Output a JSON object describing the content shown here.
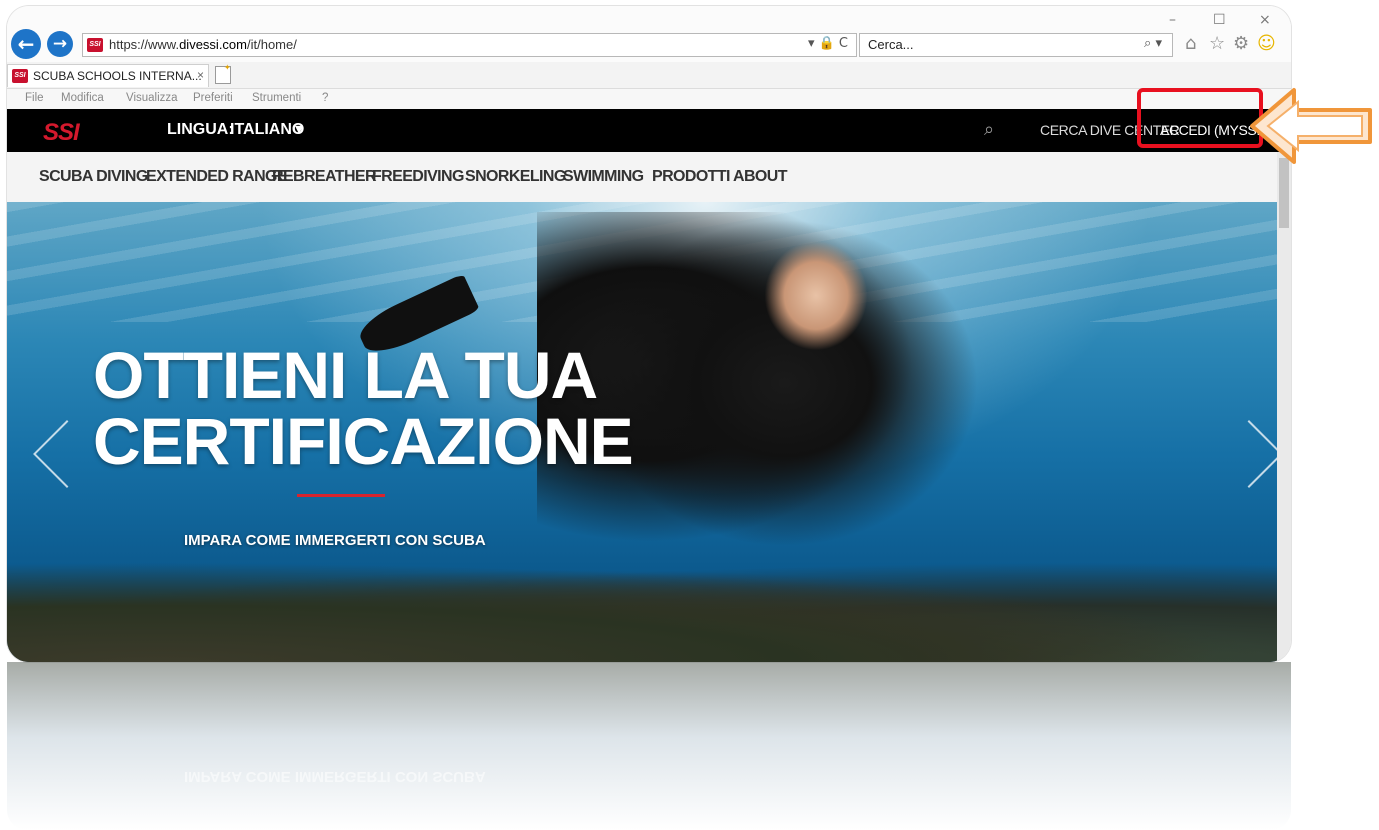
{
  "browser": {
    "url_prefix": "https://www.",
    "url_domain": "divessi.com",
    "url_path": "/it/home/",
    "url_icons": "▾ 🔒 C",
    "search_placeholder": "Cerca...",
    "search_icon": "⌕ ▾",
    "tab_title": "SCUBA SCHOOLS INTERNA...",
    "tab_close": "×",
    "favicon_text": "SSI",
    "window_controls": {
      "minimize": "–",
      "maximize": "☐",
      "close": "×"
    },
    "toolbar_icons": {
      "home": "⌂",
      "favorites": "☆",
      "settings": "⚙",
      "feedback": "☺"
    },
    "menu": [
      "File",
      "Modifica",
      "Visualizza",
      "Preferiti",
      "Strumenti",
      "?"
    ]
  },
  "site": {
    "logo": "SSI",
    "language_label": "LINGUA:",
    "language_value": "ITALIANO",
    "language_caret": "▾",
    "search_icon": "🔍",
    "find_dive_center": "CERCA DIVE CENTER",
    "login": "ACCEDI (MYSSI)",
    "nav": [
      "SCUBA DIVING",
      "EXTENDED RANGE",
      "REBREATHER",
      "FREEDIVING",
      "SNORKELING",
      "SWIMMING",
      "PRODOTTI",
      "ABOUT"
    ],
    "hero": {
      "headline_line1": "OTTIENI LA TUA",
      "headline_line2": "CERTIFICAZIONE",
      "subline": "IMPARA COME IMMERGERTI CON SCUBA"
    }
  },
  "annotation": {
    "highlight_color": "#e8101f",
    "arrow_color": "#f0963a"
  }
}
